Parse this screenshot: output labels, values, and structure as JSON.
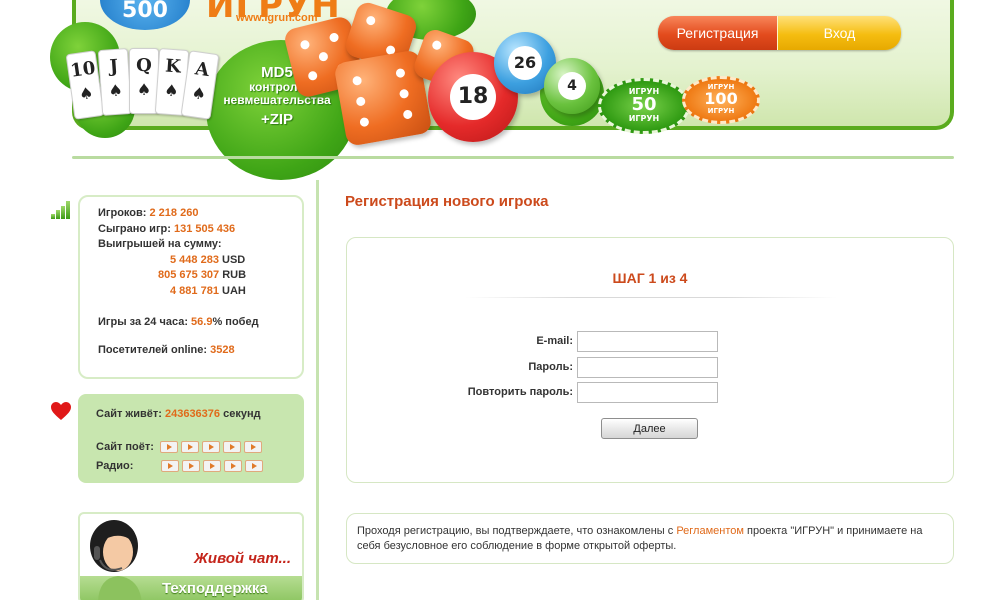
{
  "header": {
    "logo_text": "ИГРУН",
    "logo_url": "www.Igrun.com",
    "md5_title": "MD5",
    "md5_line1": "контроль",
    "md5_line2": "невмешательства",
    "md5_zip": "+ZIP",
    "cards": [
      "10",
      "J",
      "Q",
      "K",
      "A"
    ],
    "balls": [
      "18",
      "26",
      "4"
    ],
    "chips": [
      {
        "line1": "ИГРУН",
        "num": "50",
        "line2": "ИГРУН"
      },
      {
        "line1": "ИГРУН",
        "num": "100",
        "line2": "ИГРУН"
      }
    ],
    "register_label": "Регистрация",
    "login_label": "Вход"
  },
  "stats": {
    "players_label": "Игроков:",
    "players_value": "2 218 260",
    "games_label": "Сыграно игр:",
    "games_value": "131 505 436",
    "winnings_label": "Выигрышей на сумму:",
    "winnings": [
      {
        "value": "5 448 283",
        "currency": "USD"
      },
      {
        "value": "805 675 307",
        "currency": "RUB"
      },
      {
        "value": "4 881 781",
        "currency": "UAH"
      }
    ],
    "day_games_label": "Игры за 24 часа:",
    "day_games_value": "56.9",
    "day_games_suffix": "% побед",
    "online_label": "Посетителей online:",
    "online_value": "3528"
  },
  "alive": {
    "label": "Сайт живёт:",
    "seconds_value": "243636376",
    "seconds_suffix": "секунд",
    "sings_label": "Сайт поёт:",
    "radio_label": "Радио:"
  },
  "chat": {
    "title": "Живой чат...",
    "subtitle": "Техподдержка"
  },
  "main": {
    "title": "Регистрация нового игрока",
    "step": "ШАГ 1 из 4",
    "email_label": "E-mail:",
    "email_value": "",
    "password_label": "Пароль:",
    "password_value": "",
    "password_repeat_label": "Повторить пароль:",
    "password_repeat_value": "",
    "next_label": "Далее"
  },
  "notice": {
    "text_before": "Проходя регистрацию, вы подтверждаете, что ознакомлены с ",
    "link_text": "Регламентом",
    "text_after": " проекта \"ИГРУН\" и принимаете на себя безусловное его соблюдение в форме открытой оферты."
  },
  "colors": {
    "accent_orange": "#e06a1a",
    "title_red": "#cc4a1c",
    "green_border": "#5aab1e",
    "register_button": "#e34b1d",
    "login_button": "#f5bd10"
  }
}
